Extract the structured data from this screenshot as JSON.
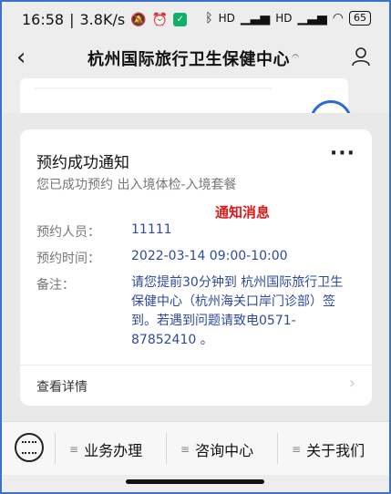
{
  "status_bar": {
    "time": "16:58",
    "network_speed": "3.8K/s",
    "battery": "65",
    "signal_label_1": "HD",
    "signal_label_2": "HD"
  },
  "nav": {
    "back_icon": "chevron-left-icon",
    "title": "杭州国际旅行卫生保健中心",
    "person_icon": "person-icon"
  },
  "card": {
    "title": "预约成功通知",
    "subtitle": "您已成功预约 出入境体检-入境套餐",
    "annotation": "通知消息",
    "rows": [
      {
        "label": "预约人员：",
        "value": "11111"
      },
      {
        "label": "预约时间：",
        "value": "2022-03-14 09:00-10:00"
      }
    ],
    "note_label": "备注：",
    "note_value": "请您提前30分钟到 杭州国际旅行卫生保健中心（杭州海关口岸门诊部）签到。若遇到问题请致电0571-87852410 。",
    "detail_label": "查看详情"
  },
  "menu": {
    "items": [
      {
        "label": "业务办理"
      },
      {
        "label": "咨询中心"
      },
      {
        "label": "关于我们"
      }
    ]
  },
  "colors": {
    "frame_border": "#3a73c8",
    "value_text": "#2e4a9f",
    "annotation_red": "#e01818"
  }
}
